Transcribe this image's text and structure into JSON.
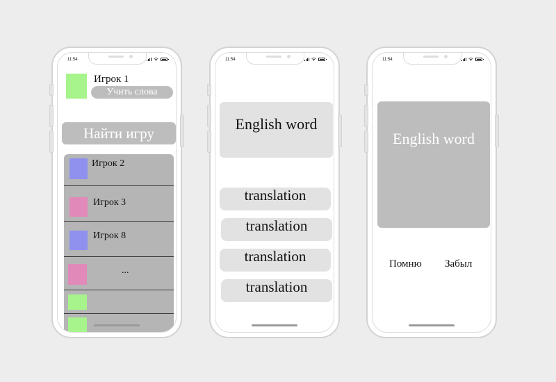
{
  "status": {
    "time": "11:54"
  },
  "screen1": {
    "current_player": {
      "name": "Игрок 1",
      "avatar_color": "#a7f48c"
    },
    "learn_button_label": "Учить слова",
    "find_game_button_label": "Найти игру",
    "players": [
      {
        "name": "Игрок 2",
        "avatar_color": "#9090ef"
      },
      {
        "name": "Игрок 3",
        "avatar_color": "#e189b9"
      },
      {
        "name": "Игрок 8",
        "avatar_color": "#9090ef"
      },
      {
        "name": "...",
        "avatar_color": "#e189b9"
      },
      {
        "name": "",
        "avatar_color": "#a7f48c"
      },
      {
        "name": "",
        "avatar_color": "#a7f48c"
      }
    ]
  },
  "screen2": {
    "word": "English word",
    "options": [
      "translation",
      "translation",
      "translation",
      "translation"
    ]
  },
  "screen3": {
    "word": "English word",
    "remember_label": "Помню",
    "forgot_label": "Забыл"
  },
  "colors": {
    "background": "#ededed",
    "card_light": "#e2e2e2",
    "card_dark": "#bdbdbd",
    "panel": "#b5b5b5"
  }
}
